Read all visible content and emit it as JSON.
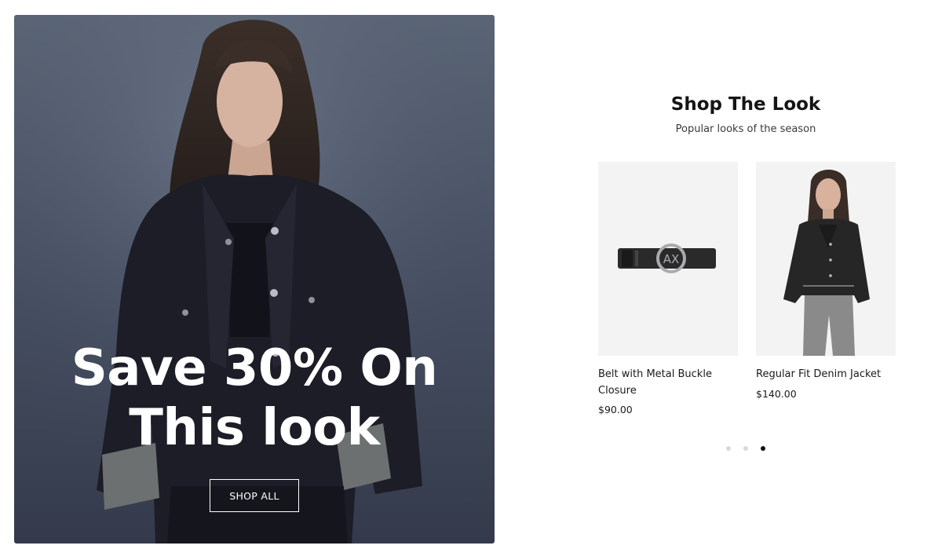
{
  "hero": {
    "title_line_1": "Save 30% On",
    "title_line_2": "This look",
    "cta_label": "SHOP ALL"
  },
  "section": {
    "title": "Shop The Look",
    "subtitle": "Popular looks of the season"
  },
  "products": [
    {
      "name": "Belt with Metal Buckle Closure",
      "price": "$90.00"
    },
    {
      "name": "Regular Fit Denim Jacket",
      "price": "$140.00"
    }
  ],
  "carousel": {
    "page_count": 3,
    "active_page": 3
  }
}
